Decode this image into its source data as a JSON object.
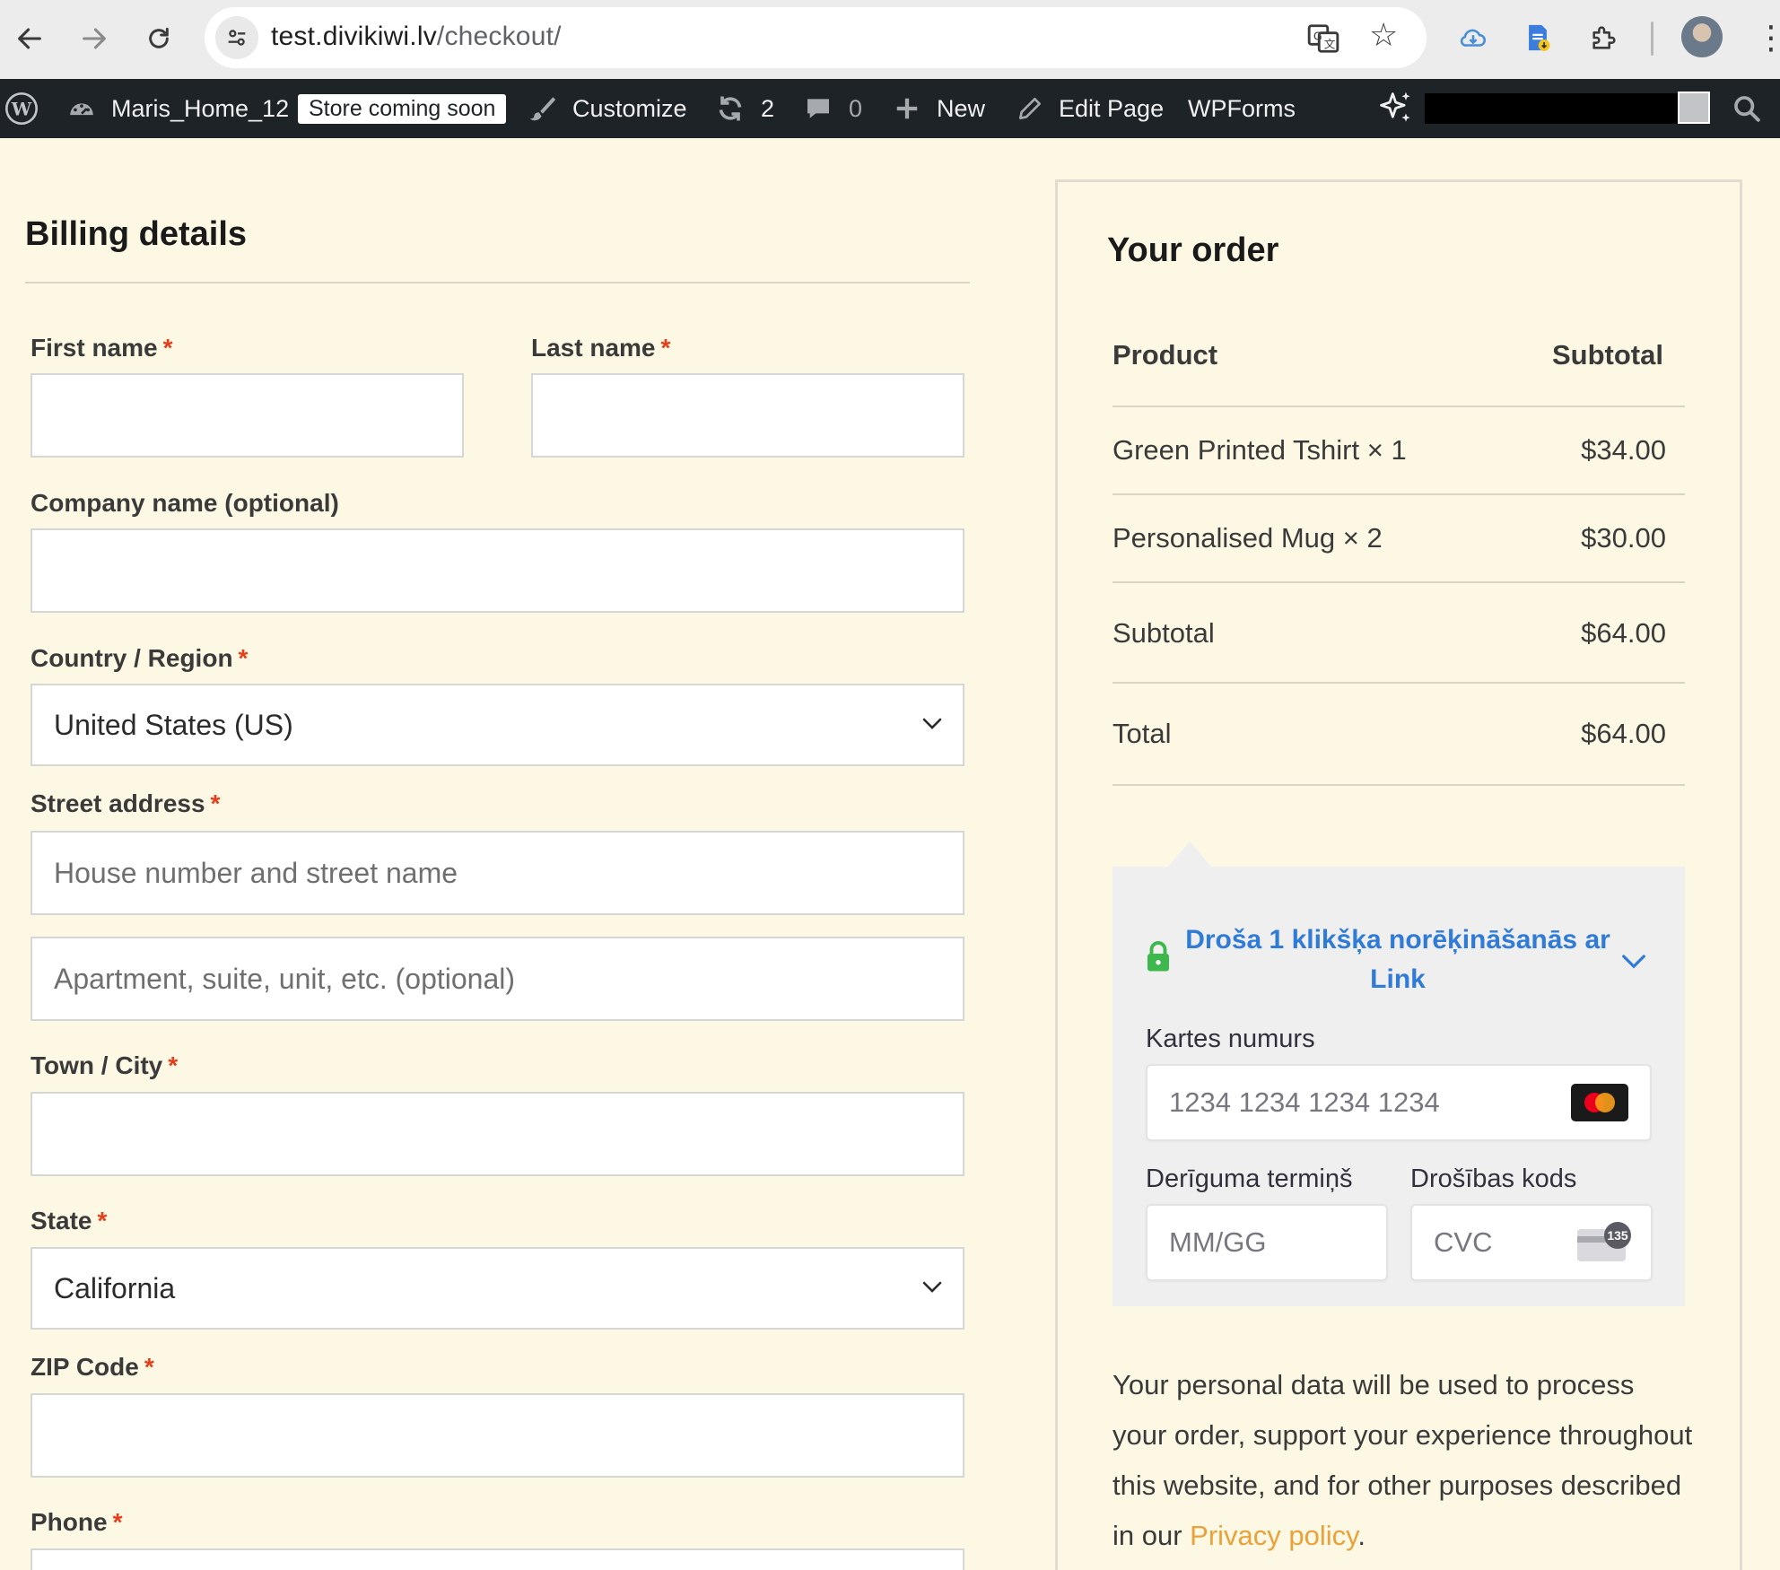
{
  "browser": {
    "url_host": "test.divikiwi.lv",
    "url_path": "/checkout/"
  },
  "admin_bar": {
    "site_name": "Maris_Home_12",
    "store_badge": "Store coming soon",
    "customize": "Customize",
    "updates_count": "2",
    "comments_count": "0",
    "new": "New",
    "edit_page": "Edit Page",
    "wpforms": "WPForms"
  },
  "billing": {
    "title": "Billing details",
    "first_name_label": "First name",
    "last_name_label": "Last name",
    "company_label": "Company name (optional)",
    "country_label": "Country / Region",
    "country_value": "United States (US)",
    "street_label": "Street address",
    "street_placeholder": "House number and street name",
    "apartment_placeholder": "Apartment, suite, unit, etc. (optional)",
    "city_label": "Town / City",
    "state_label": "State",
    "state_value": "California",
    "zip_label": "ZIP Code",
    "phone_label": "Phone",
    "required_mark": "*"
  },
  "order": {
    "title": "Your order",
    "col_product": "Product",
    "col_subtotal": "Subtotal",
    "items": [
      {
        "name": "Green Printed Tshirt",
        "qty": "× 1",
        "price": "$34.00"
      },
      {
        "name": "Personalised Mug",
        "qty": "× 2",
        "price": "$30.00"
      }
    ],
    "subtotal_label": "Subtotal",
    "subtotal_value": "$64.00",
    "total_label": "Total",
    "total_value": "$64.00"
  },
  "payment": {
    "link_text": "Droša 1 klikšķa norēķināšanās ar Link",
    "card_number_label": "Kartes numurs",
    "card_number_placeholder": "1234 1234 1234 1234",
    "expiry_label": "Derīguma termiņš",
    "expiry_placeholder": "MM/GG",
    "cvc_label": "Drošības kods",
    "cvc_placeholder": "CVC",
    "cvc_badge": "135"
  },
  "privacy": {
    "text": "Your personal data will be used to process your order, support your experience throughout this website, and for other purposes described in our ",
    "link": "Privacy policy",
    "end": "."
  },
  "colors": {
    "page_bg": "#fdf8e3",
    "admin_bar": "#1d2327",
    "required": "#e2401c",
    "link_blue": "#2f7bd6",
    "privacy_link": "#e9a23b",
    "lock_green": "#3db84c"
  },
  "icons": [
    "back-arrow-icon",
    "forward-arrow-icon",
    "reload-icon",
    "site-settings-icon",
    "translate-icon",
    "star-icon",
    "cloud-icon",
    "document-icon",
    "extensions-icon",
    "menu-icon",
    "wordpress-icon",
    "dashboard-icon",
    "brush-icon",
    "refresh-icon",
    "comment-icon",
    "plus-icon",
    "pencil-icon",
    "sparkle-icon",
    "search-icon",
    "chevron-down-icon",
    "lock-icon",
    "mastercard-icon",
    "cvc-card-icon"
  ]
}
